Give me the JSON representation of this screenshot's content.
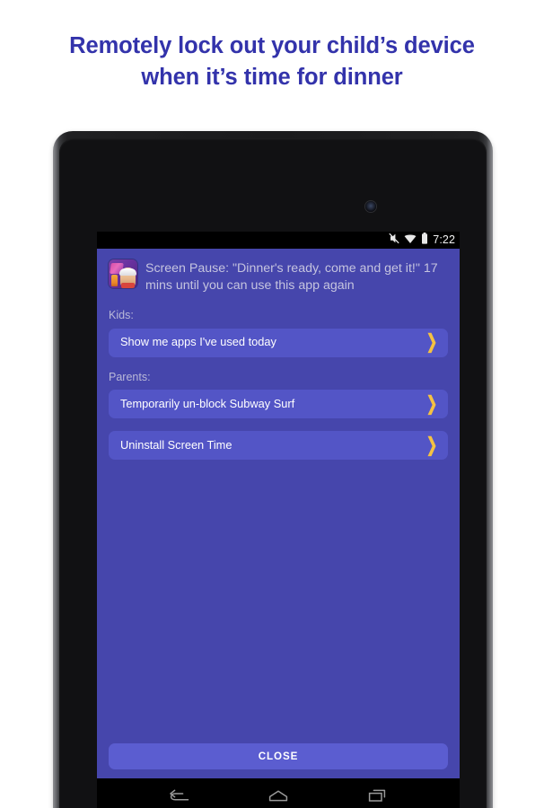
{
  "headline": {
    "line1": "Remotely lock out your child’s device",
    "line2": "when it’s time for dinner",
    "color": "#3333ab"
  },
  "device": {
    "type": "android-tablet",
    "camera_icon": "front-camera-icon"
  },
  "statusbar": {
    "icons": [
      "vibrate-muted-icon",
      "wifi-icon",
      "battery-icon"
    ],
    "clock": "7:22",
    "background": "#000000",
    "text_color": "#f2f2f2"
  },
  "panel": {
    "background": "#4646ac",
    "accent_row": "#5355c6",
    "chevron_color": "#f5c242"
  },
  "notification": {
    "app_icon": "subway-surfers-app-icon",
    "message": "Screen Pause: \"Dinner's ready, come and get it!\" 17 mins until you can use this app again",
    "text_color": "#c5c4df"
  },
  "sections": [
    {
      "label": "Kids:",
      "rows": [
        {
          "label": "Show me apps I've used today",
          "chevron": "❯",
          "chevron_icon": "chevron-right-icon"
        }
      ]
    },
    {
      "label": "Parents:",
      "rows": [
        {
          "label": "Temporarily un-block Subway Surf",
          "chevron": "❯",
          "chevron_icon": "chevron-right-icon"
        },
        {
          "label": "Uninstall Screen Time",
          "chevron": "❯",
          "chevron_icon": "chevron-right-icon"
        }
      ]
    }
  ],
  "close_button": {
    "label": "CLOSE",
    "background": "#5b5dd0"
  },
  "navbar": {
    "buttons": [
      {
        "name": "back-icon",
        "label": "Back"
      },
      {
        "name": "home-icon",
        "label": "Home"
      },
      {
        "name": "recents-icon",
        "label": "Recents"
      }
    ],
    "background": "#000000",
    "icon_color": "#9a9a9a"
  }
}
